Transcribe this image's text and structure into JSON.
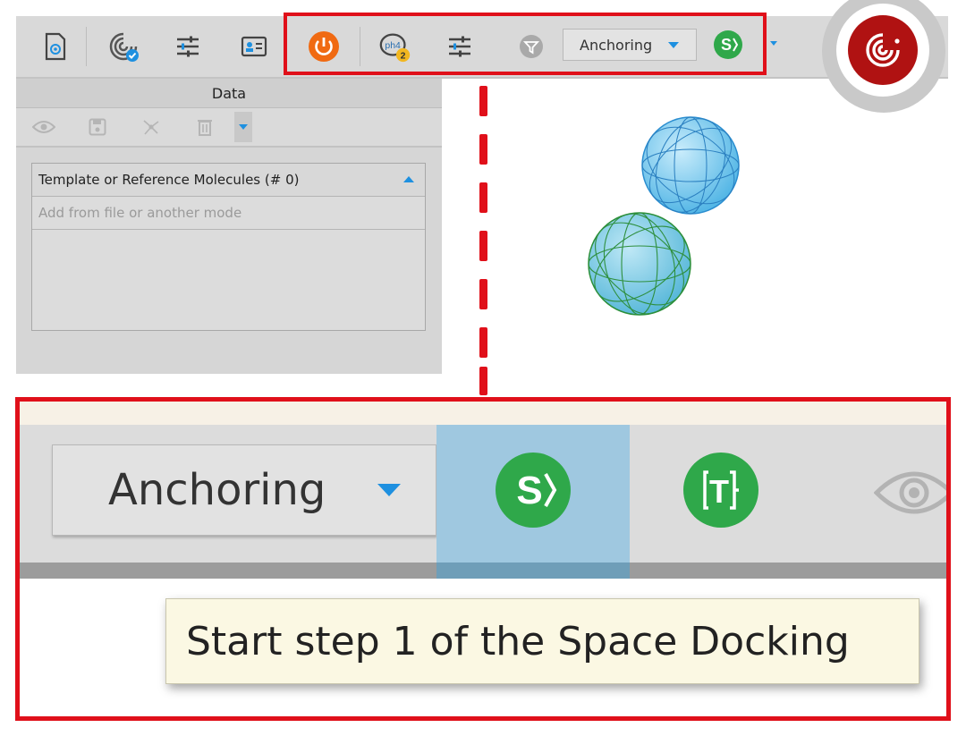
{
  "toolbar": {
    "mode_dropdown": {
      "selected": "Anchoring"
    },
    "ph4_badge": "2",
    "space_docking_label": "S",
    "ph4_label": "ph4"
  },
  "data_panel": {
    "title": "Data",
    "template_section": {
      "header": "Template or Reference Molecules (# 0)",
      "placeholder": "Add from file or another mode"
    }
  },
  "zoom": {
    "mode_dropdown": {
      "selected": "Anchoring"
    },
    "s_button_label": "S",
    "t_button_label": "T",
    "tooltip": "Start step 1 of the Space Docking"
  },
  "colors": {
    "highlight": "#e0101a",
    "accent_blue": "#1e90e0",
    "green_button": "#2fa84a",
    "power_orange": "#f06a12",
    "logo_red": "#b01212",
    "selected_bg": "#9fc8e0"
  },
  "icons": [
    "file-target-icon",
    "galaxy-check-icon",
    "sliders-icon",
    "contact-card-icon",
    "power-icon",
    "ph4-icon",
    "sliders-icon",
    "filter-icon",
    "space-docking-s-icon",
    "logo-icon",
    "eye-icon",
    "save-icon",
    "network-icon",
    "trash-icon",
    "template-t-icon"
  ]
}
